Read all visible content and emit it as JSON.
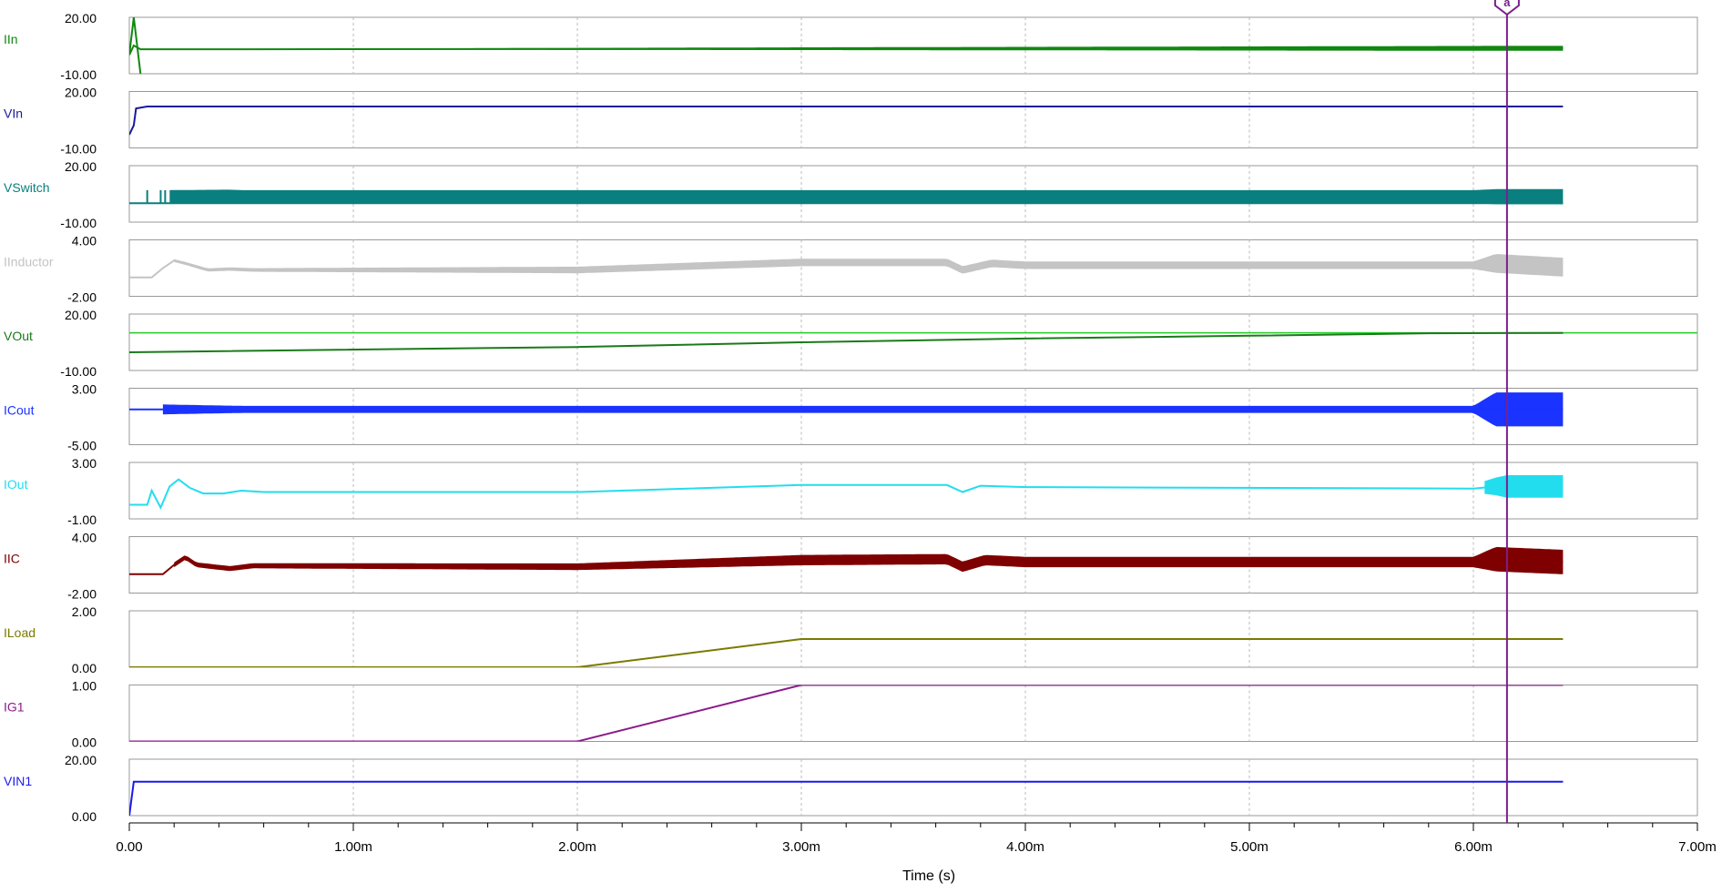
{
  "chart_data": {
    "type": "line",
    "xlabel": "Time (s)",
    "xlim": [
      0,
      7
    ],
    "x_unit_suffix": "m",
    "x_ticks": [
      "0.00",
      "1.00m",
      "2.00m",
      "3.00m",
      "4.00m",
      "5.00m",
      "6.00m",
      "7.00m"
    ],
    "grid": true,
    "cursor": {
      "x": 6.15,
      "label": "a",
      "color": "#7a1f8c"
    },
    "panels": [
      {
        "name": "IIn",
        "color": "#118811",
        "ylim": [
          -10,
          20
        ],
        "ytick_labels": [
          "20.00",
          "-10.00"
        ],
        "style": "ripple",
        "points": [
          [
            0,
            0
          ],
          [
            0.02,
            5
          ],
          [
            0.05,
            3
          ],
          [
            0.5,
            3
          ],
          [
            3.0,
            3.3
          ],
          [
            6.1,
            3.5
          ],
          [
            6.4,
            3.5
          ]
        ],
        "band": [
          [
            0.2,
            0.4
          ],
          [
            6.1,
            2.6
          ],
          [
            6.4,
            2.6
          ]
        ],
        "spike": [
          [
            0.02,
            20
          ],
          [
            0.05,
            -10
          ]
        ]
      },
      {
        "name": "VIn",
        "color": "#1a1a99",
        "ylim": [
          -10,
          20
        ],
        "ytick_labels": [
          "20.00",
          "-10.00"
        ],
        "style": "line",
        "points": [
          [
            0,
            -3
          ],
          [
            0.02,
            2
          ],
          [
            0.03,
            11
          ],
          [
            0.08,
            12
          ],
          [
            6.4,
            12
          ]
        ]
      },
      {
        "name": "VSwitch",
        "color": "#0a7f7f",
        "ylim": [
          -10,
          20
        ],
        "ytick_labels": [
          "20.00",
          "-10.00"
        ],
        "style": "switch",
        "points": [
          [
            0,
            0
          ],
          [
            0.18,
            0
          ],
          [
            6.4,
            0
          ]
        ],
        "band": [
          [
            0.18,
            7
          ],
          [
            0.45,
            7.5
          ],
          [
            0.5,
            7
          ],
          [
            6.0,
            7
          ],
          [
            6.1,
            8
          ],
          [
            6.4,
            8
          ]
        ],
        "center": [
          [
            0.18,
            3.5
          ],
          [
            6.4,
            3.5
          ]
        ]
      },
      {
        "name": "IInductor",
        "color": "#c4c4c4",
        "ylim": [
          -2,
          4
        ],
        "ytick_labels": [
          "4.00",
          "-2.00"
        ],
        "style": "ripple",
        "points": [
          [
            0,
            0
          ],
          [
            0.1,
            0
          ],
          [
            0.15,
            1
          ],
          [
            0.2,
            1.8
          ],
          [
            0.25,
            1.5
          ],
          [
            0.35,
            0.8
          ],
          [
            0.45,
            0.9
          ],
          [
            0.55,
            0.8
          ],
          [
            2.0,
            0.8
          ],
          [
            3.0,
            1.6
          ],
          [
            3.65,
            1.6
          ],
          [
            3.72,
            0.8
          ],
          [
            3.85,
            1.5
          ],
          [
            4.0,
            1.3
          ],
          [
            6.0,
            1.3
          ],
          [
            6.1,
            1.5
          ],
          [
            6.4,
            1.1
          ]
        ],
        "band": [
          [
            0.2,
            0.3
          ],
          [
            2.0,
            0.7
          ],
          [
            3.0,
            0.8
          ],
          [
            6.0,
            0.8
          ],
          [
            6.1,
            2.0
          ],
          [
            6.4,
            2.0
          ]
        ]
      },
      {
        "name": "VOut",
        "color": "#1a7a1a",
        "ylim": [
          -10,
          20
        ],
        "ytick_labels": [
          "20.00",
          "-10.00"
        ],
        "style": "line",
        "points": [
          [
            0,
            -0.3
          ],
          [
            2.0,
            2.5
          ],
          [
            3.0,
            5.0
          ],
          [
            4.0,
            7.0
          ],
          [
            5.0,
            8.5
          ],
          [
            5.8,
            9.8
          ],
          [
            6.4,
            10.0
          ]
        ],
        "setpoint": {
          "value": 10.0,
          "color": "#22cc22"
        }
      },
      {
        "name": "ICout",
        "color": "#1a33ff",
        "ylim": [
          -5,
          3
        ],
        "ytick_labels": [
          "3.00",
          "-5.00"
        ],
        "style": "ripple",
        "points": [
          [
            0,
            0
          ],
          [
            6.4,
            0
          ]
        ],
        "band": [
          [
            0.15,
            1.4
          ],
          [
            0.5,
            1.0
          ],
          [
            6.0,
            1.0
          ],
          [
            6.1,
            4.8
          ],
          [
            6.4,
            4.8
          ]
        ]
      },
      {
        "name": "IOut",
        "color": "#22ddee",
        "ylim": [
          -1,
          3
        ],
        "ytick_labels": [
          "3.00",
          "-1.00"
        ],
        "style": "line",
        "points": [
          [
            0,
            0
          ],
          [
            0.08,
            0
          ],
          [
            0.1,
            1.0
          ],
          [
            0.12,
            0.4
          ],
          [
            0.14,
            -0.2
          ],
          [
            0.18,
            1.3
          ],
          [
            0.22,
            1.8
          ],
          [
            0.27,
            1.2
          ],
          [
            0.33,
            0.8
          ],
          [
            0.42,
            0.8
          ],
          [
            0.5,
            1.0
          ],
          [
            0.6,
            0.9
          ],
          [
            2.0,
            0.9
          ],
          [
            3.0,
            1.4
          ],
          [
            3.65,
            1.4
          ],
          [
            3.72,
            0.9
          ],
          [
            3.8,
            1.35
          ],
          [
            4.0,
            1.25
          ],
          [
            6.0,
            1.15
          ],
          [
            6.1,
            1.3
          ],
          [
            6.4,
            1.3
          ]
        ],
        "band": [
          [
            6.05,
            0.9
          ],
          [
            6.15,
            1.6
          ],
          [
            6.4,
            1.6
          ]
        ]
      },
      {
        "name": "IIC",
        "color": "#7f0000",
        "ylim": [
          -2,
          4
        ],
        "ytick_labels": [
          "4.00",
          "-2.00"
        ],
        "style": "ripple",
        "points": [
          [
            0,
            0
          ],
          [
            0.15,
            0
          ],
          [
            0.2,
            1.0
          ],
          [
            0.25,
            1.8
          ],
          [
            0.3,
            1.0
          ],
          [
            0.45,
            0.6
          ],
          [
            0.55,
            0.9
          ],
          [
            2.0,
            0.8
          ],
          [
            3.0,
            1.5
          ],
          [
            3.65,
            1.6
          ],
          [
            3.72,
            0.8
          ],
          [
            3.82,
            1.5
          ],
          [
            4.0,
            1.3
          ],
          [
            6.0,
            1.3
          ],
          [
            6.1,
            1.6
          ],
          [
            6.4,
            1.3
          ]
        ],
        "band": [
          [
            0.2,
            0.5
          ],
          [
            2.0,
            0.7
          ],
          [
            3.0,
            1.1
          ],
          [
            6.0,
            1.1
          ],
          [
            6.1,
            2.6
          ],
          [
            6.4,
            2.6
          ]
        ]
      },
      {
        "name": "ILoad",
        "color": "#7a7a00",
        "ylim": [
          0,
          2
        ],
        "ytick_labels": [
          "2.00",
          "0.00"
        ],
        "style": "line",
        "points": [
          [
            0,
            0
          ],
          [
            2.0,
            0
          ],
          [
            3.0,
            1.0
          ],
          [
            6.4,
            1.0
          ]
        ]
      },
      {
        "name": "IG1",
        "color": "#8b1a8b",
        "ylim": [
          0,
          1
        ],
        "ytick_labels": [
          "1.00",
          "0.00"
        ],
        "style": "line",
        "points": [
          [
            0,
            0
          ],
          [
            2.0,
            0
          ],
          [
            3.0,
            1.0
          ],
          [
            6.4,
            1.0
          ]
        ]
      },
      {
        "name": "VIN1",
        "color": "#1a1aee",
        "ylim": [
          0,
          20
        ],
        "ytick_labels": [
          "20.00",
          "0.00"
        ],
        "style": "line",
        "points": [
          [
            0,
            0
          ],
          [
            0.02,
            12
          ],
          [
            6.4,
            12
          ]
        ]
      }
    ]
  }
}
